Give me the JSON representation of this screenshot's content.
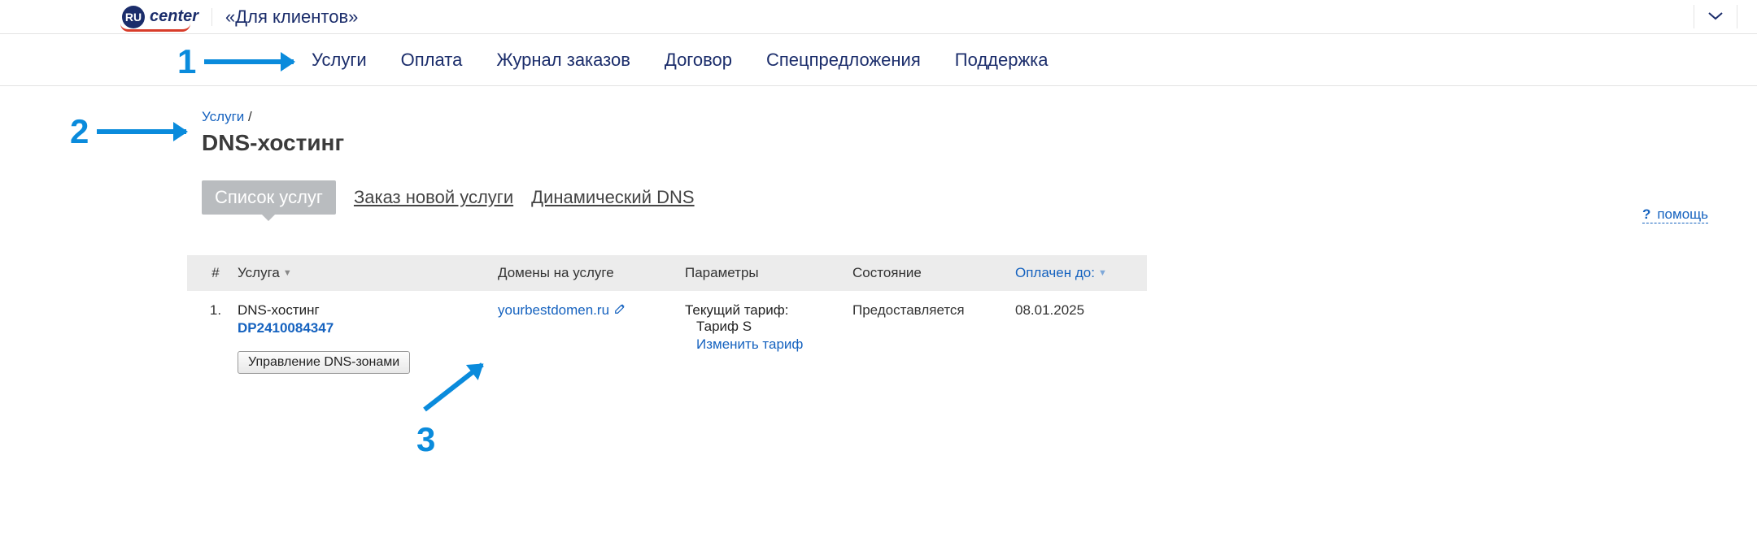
{
  "topbar": {
    "logo_circle": "RU",
    "logo_text": "center",
    "clients_tab": "«Для клиентов»"
  },
  "mainnav": {
    "items": [
      "Услуги",
      "Оплата",
      "Журнал заказов",
      "Договор",
      "Спецпредложения",
      "Поддержка"
    ]
  },
  "breadcrumb": {
    "parent": "Услуги",
    "sep": "/"
  },
  "page_title": "DNS-хостинг",
  "subtabs": {
    "items": [
      {
        "label": "Список услуг",
        "active": true
      },
      {
        "label": "Заказ новой услуги",
        "active": false
      },
      {
        "label": "Динамический DNS",
        "active": false
      }
    ]
  },
  "help": {
    "q": "?",
    "label": "помощь"
  },
  "table": {
    "headers": {
      "num": "#",
      "service": "Услуга",
      "domains": "Домены на услуге",
      "params": "Параметры",
      "state": "Состояние",
      "paid_until": "Оплачен до:"
    },
    "rows": [
      {
        "num": "1.",
        "service_name": "DNS-хостинг",
        "service_id": "DP2410084347",
        "manage_btn": "Управление DNS-зонами",
        "domain": "yourbestdomen.ru",
        "param_line": "Текущий тариф:",
        "param_sub": "Тариф S",
        "change_link": "Изменить тариф",
        "state": "Предоставляется",
        "paid_until": "08.01.2025"
      }
    ]
  },
  "annotations": {
    "a1": "1",
    "a2": "2",
    "a3": "3"
  },
  "colors": {
    "brand_dark": "#1b2d6b",
    "link_blue": "#1562bf",
    "annotation_blue": "#0a8bdc",
    "logo_arc_red": "#d83c2a"
  }
}
